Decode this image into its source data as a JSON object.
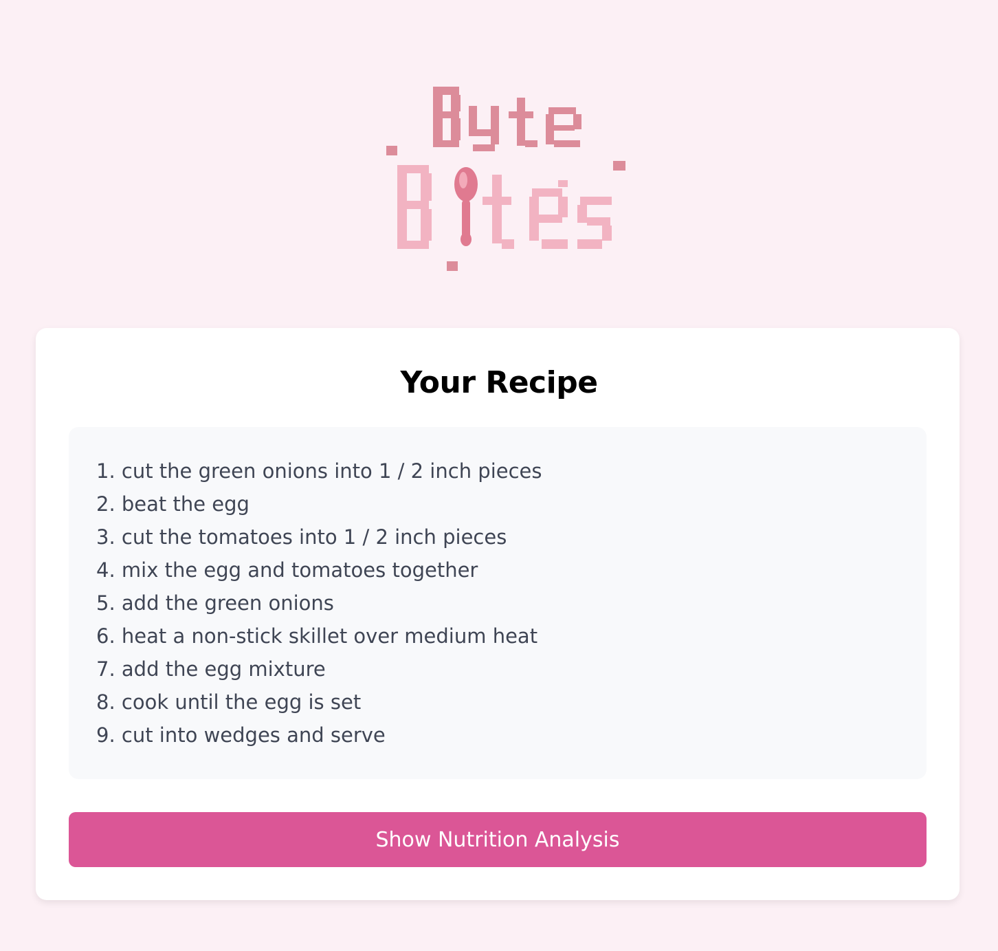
{
  "logo": {
    "text_line1": "Byte",
    "text_line2": "Bites",
    "icon": "pixel-spoon-logo",
    "colors": {
      "dark_pink": "#dc8c9a",
      "light_pink": "#f2b3c2",
      "spoon": "#e07a90"
    }
  },
  "recipe": {
    "title": "Your Recipe",
    "steps": [
      "1. cut the green onions into 1 / 2 inch pieces",
      "2. beat the egg",
      "3. cut the tomatoes into 1 / 2 inch pieces",
      "4. mix the egg and tomatoes together",
      "5. add the green onions",
      "6. heat a non-stick skillet over medium heat",
      "7. add the egg mixture",
      "8. cook until the egg is set",
      "9. cut into wedges and serve"
    ]
  },
  "actions": {
    "nutrition_button_label": "Show Nutrition Analysis"
  },
  "colors": {
    "page_background": "#fcf0f5",
    "card_background": "#ffffff",
    "steps_background": "#f8f9fb",
    "button_background": "#db5696",
    "step_text": "#3f4554"
  }
}
